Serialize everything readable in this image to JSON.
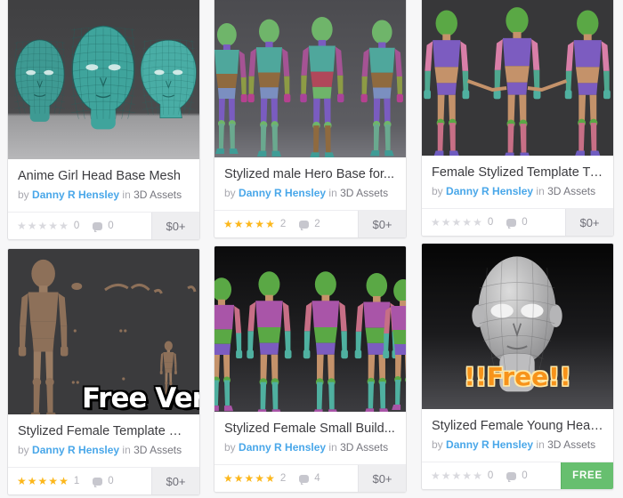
{
  "page": {
    "background_color": "#f7f7f8",
    "card_background": "#ffffff",
    "accent_author_color": "#49a7e9",
    "star_color": "#fcb71b",
    "free_badge_color": "#67bf6f"
  },
  "labels": {
    "by": "by",
    "in": "in"
  },
  "cards": [
    {
      "title": "Anime Girl Head Base Mesh",
      "author": "Danny R Hensley",
      "category": "3D Assets",
      "rating": 0,
      "rating_count": "0",
      "comment_count": "0",
      "price": "$0+",
      "price_is_free_badge": false,
      "thumb_style": "teal-heads",
      "overlay_text": "",
      "overlay_style": ""
    },
    {
      "title": "Stylized male Hero Base for...",
      "author": "Danny R Hensley",
      "category": "3D Assets",
      "rating": 5,
      "rating_count": "2",
      "comment_count": "2",
      "price": "$0+",
      "price_is_free_badge": false,
      "thumb_style": "polygroup-male",
      "overlay_text": "",
      "overlay_style": ""
    },
    {
      "title": "Female Stylized Template Type...",
      "author": "Danny R Hensley",
      "category": "3D Assets",
      "rating": 0,
      "rating_count": "0",
      "comment_count": "0",
      "price": "$0+",
      "price_is_free_badge": false,
      "thumb_style": "green-females",
      "overlay_text": "",
      "overlay_style": ""
    },
    {
      "title": "Stylized Female Template High...",
      "author": "Danny R Hensley",
      "category": "3D Assets",
      "rating": 5,
      "rating_count": "1",
      "comment_count": "0",
      "price": "$0+",
      "price_is_free_badge": false,
      "thumb_style": "clay-female",
      "overlay_text": "Free Versi",
      "overlay_style": "free-vers"
    },
    {
      "title": "Stylized Female Small Build...",
      "author": "Danny R Hensley",
      "category": "3D Assets",
      "rating": 5,
      "rating_count": "2",
      "comment_count": "4",
      "price": "$0+",
      "price_is_free_badge": false,
      "thumb_style": "polygroup-female",
      "overlay_text": "",
      "overlay_style": ""
    },
    {
      "title": "Stylized Female Young Head...",
      "author": "Danny R Hensley",
      "category": "3D Assets",
      "rating": 0,
      "rating_count": "0",
      "comment_count": "0",
      "price": "FREE",
      "price_is_free_badge": true,
      "thumb_style": "gray-head",
      "overlay_text": "!!Free!!",
      "overlay_style": "free-bang"
    }
  ]
}
